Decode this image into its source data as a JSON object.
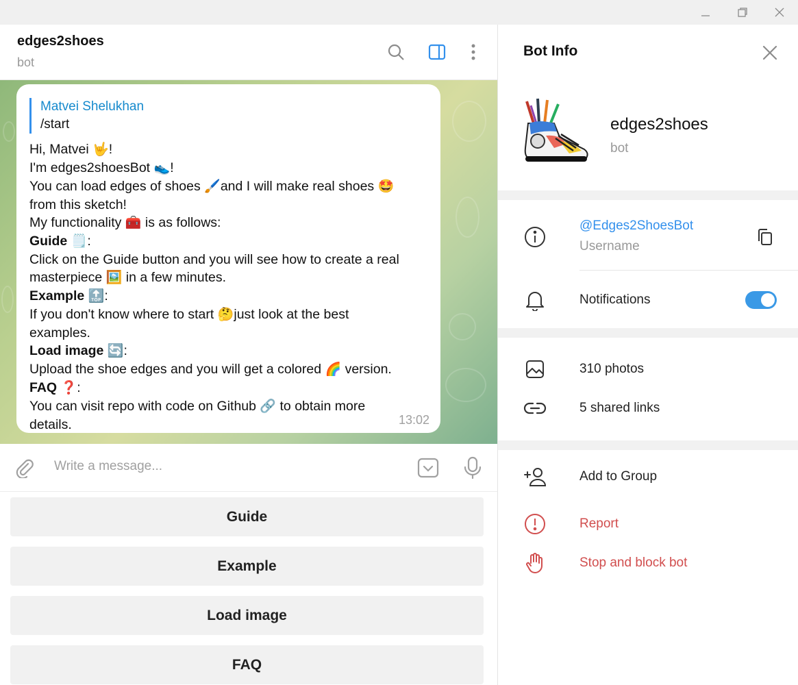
{
  "window": {
    "controls": [
      "minimize-icon",
      "restore-icon",
      "close-icon"
    ]
  },
  "chat": {
    "title": "edges2shoes",
    "subtitle": "bot",
    "header_icons": [
      "search-icon",
      "sidebar-toggle-icon",
      "more-vertical-icon"
    ],
    "message": {
      "reply_name": "Matvei Shelukhan",
      "reply_text": "/start",
      "time": "13:02",
      "lines": {
        "l1": "Hi, Matvei",
        "l1e": "🤟",
        "l1b": "!",
        "l2": "I'm edges2shoesBot",
        "l2e": "👟",
        "l2b": "!",
        "l3": "You can load edges of shoes",
        "l3e": "🖌️",
        "l3b": "and I will make real shoes",
        "l3e2": "🤩",
        "l4": "from this sketch!",
        "l5": "My functionality",
        "l5e": "🧰",
        "l5b": "is as follows:",
        "guide_h": "Guide",
        "guide_e": "🗒️",
        "guide_colon": ":",
        "guide_t1": "Click on the Guide button and you will see how to create a real",
        "guide_t2": "masterpiece",
        "guide_e2": "🖼️",
        "guide_t3": "in a few minutes.",
        "example_h": "Example",
        "example_e": "🔝",
        "example_colon": ":",
        "example_t1": "If you don't know where to start",
        "example_e2": "🤔",
        "example_t2": "just look at the best",
        "example_t3": "examples.",
        "load_h": "Load image",
        "load_e": "🔄",
        "load_colon": ":",
        "load_t1": "Upload the shoe edges and you will get a colored",
        "load_e2": "🌈",
        "load_t2": "version.",
        "faq_h": "FAQ",
        "faq_e": "❓",
        "faq_colon": ":",
        "faq_t1": "You can visit repo with code on Github",
        "faq_e2": "🔗",
        "faq_t2": "to obtain more",
        "faq_t3": "details."
      }
    },
    "composer": {
      "placeholder": "Write a message..."
    },
    "keyboard": [
      "Guide",
      "Example",
      "Load image",
      "FAQ"
    ]
  },
  "info": {
    "title": "Bot Info",
    "name": "edges2shoes",
    "type": "bot",
    "username": "@Edges2ShoesBot",
    "username_label": "Username",
    "notifications_label": "Notifications",
    "notifications_on": true,
    "photos": "310 photos",
    "links": "5 shared links",
    "add_to_group": "Add to Group",
    "report": "Report",
    "stop_block": "Stop and block bot",
    "accent_color": "#3390ec",
    "danger_color": "#d14e4e"
  }
}
